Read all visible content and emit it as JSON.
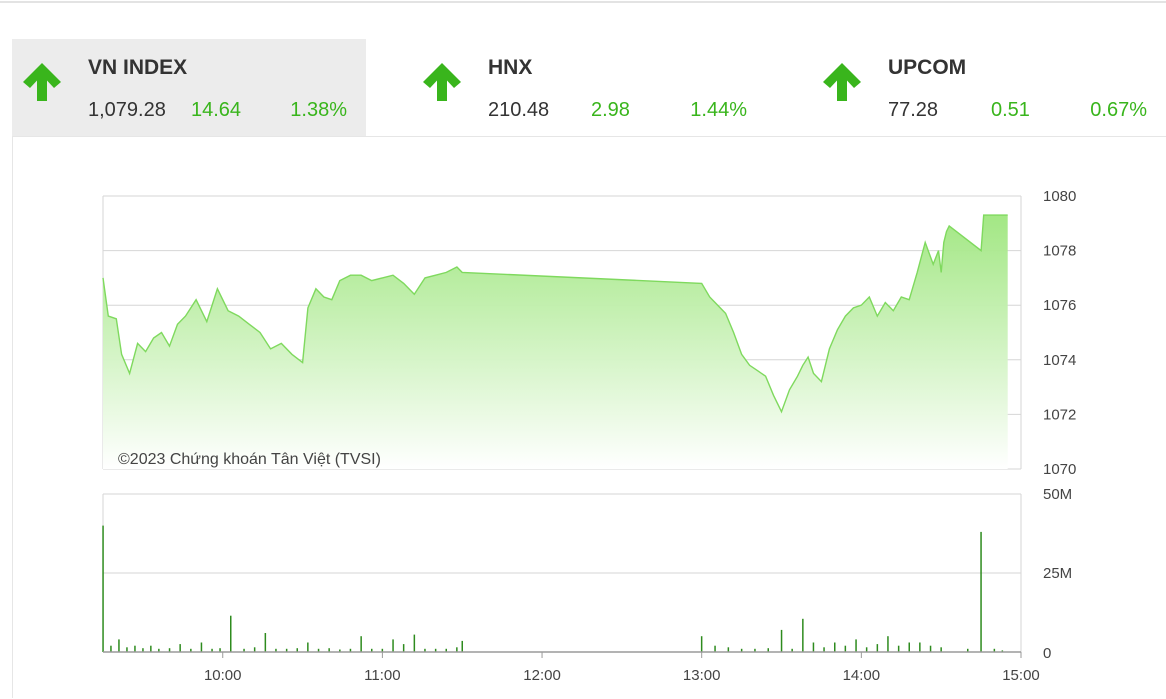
{
  "indices": [
    {
      "name": "VN INDEX",
      "value": "1,079.28",
      "change": "14.64",
      "percent": "1.38%"
    },
    {
      "name": "HNX",
      "value": "210.48",
      "change": "2.98",
      "percent": "1.44%"
    },
    {
      "name": "UPCOM",
      "value": "77.28",
      "change": "0.51",
      "percent": "0.67%"
    }
  ],
  "colors": {
    "up": "#39b51c",
    "area_fill": "#a8ec8c",
    "line": "#7fd95e",
    "volume": "#2e8b1e",
    "grid": "#d6d6d6"
  },
  "icons": {
    "up_arrow": "arrow-up-icon"
  },
  "copyright": "©2023 Chứng khoán Tân Việt (TVSI)",
  "chart_data": [
    {
      "type": "area",
      "series": [
        {
          "x": [
            "09:15",
            "09:17",
            "09:20",
            "09:22",
            "09:25",
            "09:28",
            "09:31",
            "09:34",
            "09:37",
            "09:40",
            "09:43",
            "09:46",
            "09:50",
            "09:54",
            "09:58",
            "10:02",
            "10:06",
            "10:10",
            "10:14",
            "10:18",
            "10:22",
            "10:26",
            "10:30",
            "10:32",
            "10:35",
            "10:38",
            "10:41",
            "10:44",
            "10:48",
            "10:52",
            "10:56",
            "11:00",
            "11:04",
            "11:08",
            "11:12",
            "11:16",
            "11:20",
            "11:24",
            "11:28",
            "11:30",
            "13:00",
            "13:03",
            "13:06",
            "13:09",
            "13:12",
            "13:15",
            "13:18",
            "13:21",
            "13:24",
            "13:27",
            "13:30",
            "13:33",
            "13:36",
            "13:38",
            "13:40",
            "13:42",
            "13:45",
            "13:48",
            "13:51",
            "13:54",
            "13:57",
            "14:00",
            "14:03",
            "14:06",
            "14:09",
            "14:12",
            "14:15",
            "14:18",
            "14:21",
            "14:24",
            "14:27",
            "14:29",
            "14:30",
            "14:31",
            "14:32",
            "14:33",
            "14:45",
            "14:46",
            "14:55"
          ],
          "y": [
            1077.0,
            1075.6,
            1075.5,
            1074.2,
            1073.5,
            1074.6,
            1074.3,
            1074.8,
            1075.0,
            1074.5,
            1075.3,
            1075.6,
            1076.2,
            1075.4,
            1076.6,
            1075.8,
            1075.6,
            1075.3,
            1075.0,
            1074.4,
            1074.6,
            1074.2,
            1073.9,
            1075.9,
            1076.6,
            1076.3,
            1076.2,
            1076.9,
            1077.1,
            1077.1,
            1076.9,
            1077.0,
            1077.1,
            1076.8,
            1076.4,
            1077.0,
            1077.1,
            1077.2,
            1077.4,
            1077.2,
            1076.8,
            1076.3,
            1076.0,
            1075.7,
            1075.0,
            1074.2,
            1073.8,
            1073.6,
            1073.4,
            1072.7,
            1072.1,
            1072.9,
            1073.4,
            1073.8,
            1074.1,
            1073.5,
            1073.2,
            1074.4,
            1075.1,
            1075.6,
            1075.9,
            1076.0,
            1076.3,
            1075.6,
            1076.1,
            1075.8,
            1076.3,
            1076.2,
            1077.2,
            1078.3,
            1077.5,
            1078.0,
            1077.2,
            1078.3,
            1078.7,
            1078.9,
            1078.0,
            1079.3,
            1079.3
          ],
          "color": "#7fd95e"
        }
      ],
      "x_ticks": [
        "10:00",
        "11:00",
        "12:00",
        "13:00",
        "14:00",
        "15:00"
      ],
      "y_ticks": [
        "1080",
        "1078",
        "1076",
        "1074",
        "1072",
        "1070"
      ],
      "ylim": [
        1070,
        1080
      ],
      "xlim": [
        "09:15",
        "15:00"
      ],
      "grid": true
    },
    {
      "type": "bar",
      "series": [
        {
          "x": [
            "09:15",
            "09:18",
            "09:21",
            "09:24",
            "09:27",
            "09:30",
            "09:33",
            "09:36",
            "09:40",
            "09:44",
            "09:48",
            "09:52",
            "09:56",
            "09:59",
            "10:03",
            "10:08",
            "10:12",
            "10:16",
            "10:20",
            "10:24",
            "10:28",
            "10:32",
            "10:36",
            "10:40",
            "10:44",
            "10:48",
            "10:52",
            "10:56",
            "11:00",
            "11:04",
            "11:08",
            "11:12",
            "11:16",
            "11:20",
            "11:24",
            "11:28",
            "11:30",
            "13:00",
            "13:05",
            "13:10",
            "13:15",
            "13:20",
            "13:25",
            "13:30",
            "13:34",
            "13:38",
            "13:42",
            "13:46",
            "13:50",
            "13:54",
            "13:58",
            "14:02",
            "14:06",
            "14:10",
            "14:14",
            "14:18",
            "14:22",
            "14:26",
            "14:30",
            "14:40",
            "14:45",
            "14:50",
            "14:53"
          ],
          "y": [
            40.0,
            2.0,
            4.0,
            1.5,
            2.0,
            1.2,
            2.0,
            1.0,
            1.2,
            2.5,
            1.0,
            3.0,
            1.0,
            1.2,
            11.5,
            1.0,
            1.5,
            6.0,
            1.0,
            1.0,
            1.2,
            3.0,
            1.0,
            1.2,
            0.8,
            1.0,
            5.0,
            1.0,
            1.0,
            4.0,
            2.5,
            5.5,
            1.0,
            1.0,
            1.0,
            1.5,
            3.5,
            5.0,
            2.0,
            1.5,
            1.0,
            1.0,
            1.2,
            7.0,
            1.0,
            10.5,
            3.0,
            1.5,
            3.0,
            2.0,
            4.0,
            1.5,
            2.5,
            5.0,
            2.0,
            3.0,
            3.0,
            2.0,
            1.5,
            1.0,
            38.0,
            1.0,
            0.5
          ],
          "color": "#2e8b1e"
        }
      ],
      "y_ticks": [
        "50M",
        "25M",
        "0"
      ],
      "ylim": [
        0,
        50
      ],
      "grid": true
    }
  ]
}
